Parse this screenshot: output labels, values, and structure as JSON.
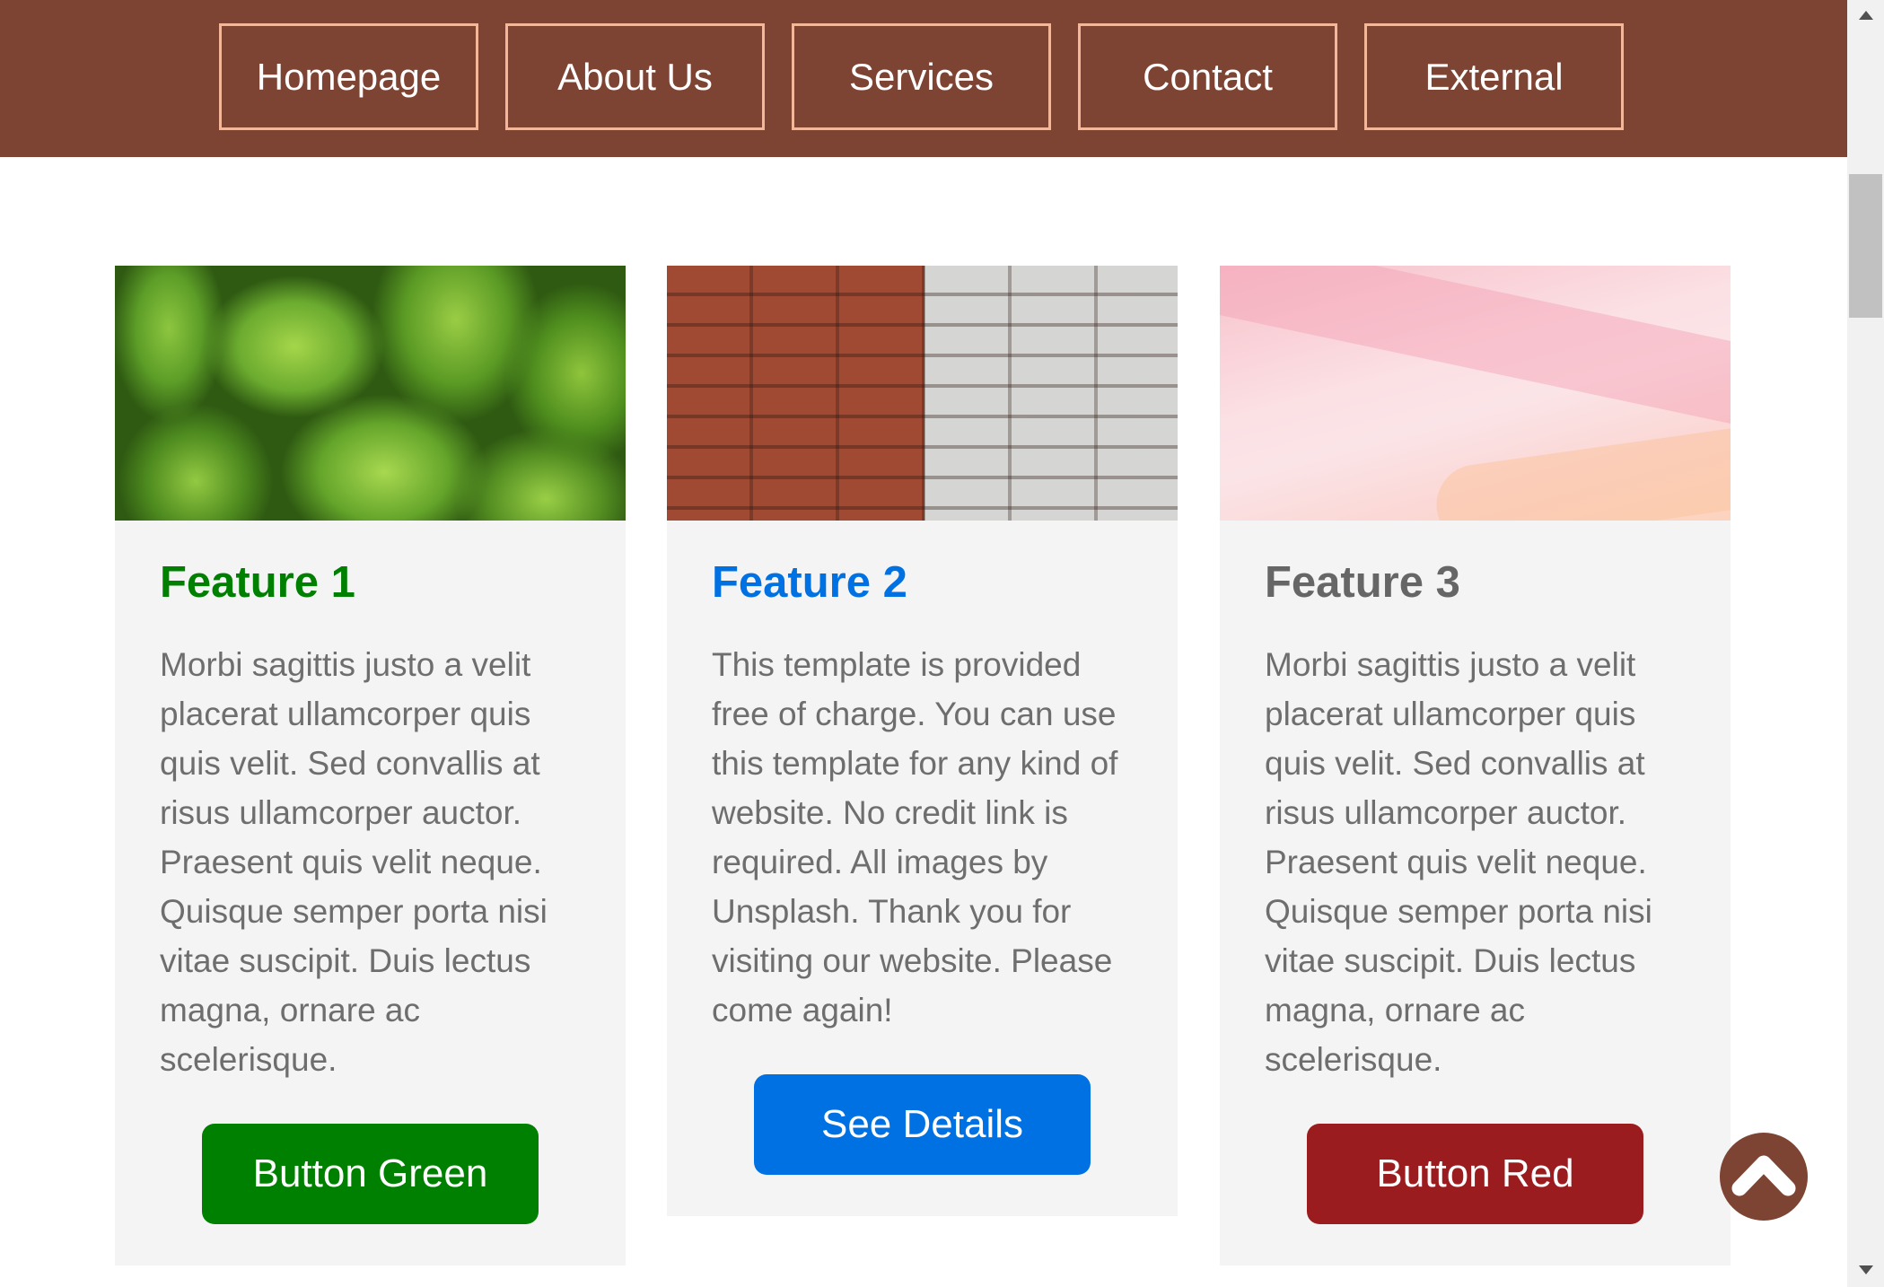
{
  "nav": {
    "items": [
      {
        "label": "Homepage"
      },
      {
        "label": "About Us"
      },
      {
        "label": "Services"
      },
      {
        "label": "Contact"
      },
      {
        "label": "External"
      }
    ],
    "background": "#7e4433",
    "border_color": "#f4b79a"
  },
  "cards": [
    {
      "title": "Feature 1",
      "title_color": "#008000",
      "text": "Morbi sagittis justo a velit placerat ullamcorper quis quis velit. Sed convallis at risus ullamcorper auctor. Praesent quis velit neque. Quisque semper porta nisi vitae suscipit. Duis lectus magna, ornare ac scelerisque.",
      "button_label": "Button Green",
      "button_color": "#008000",
      "image": "green-leaves"
    },
    {
      "title": "Feature 2",
      "title_color": "#0071e3",
      "text": "This template is provided free of charge. You can use this template for any kind of website. No credit link is required. All images by Unsplash. Thank you for visiting our website. Please come again!",
      "button_label": "See Details",
      "button_color": "#0071e3",
      "image": "brick-wall"
    },
    {
      "title": "Feature 3",
      "title_color": "#666666",
      "text": "Morbi sagittis justo a velit placerat ullamcorper quis quis velit. Sed convallis at risus ullamcorper auctor. Praesent quis velit neque. Quisque semper porta nisi vitae suscipit. Duis lectus magna, ornare ac scelerisque.",
      "button_label": "Button Red",
      "button_color": "#9b1c1f",
      "image": "pink-watercolor"
    }
  ],
  "back_to_top": {
    "icon": "chevron-up-icon",
    "color": "#7e4433"
  }
}
